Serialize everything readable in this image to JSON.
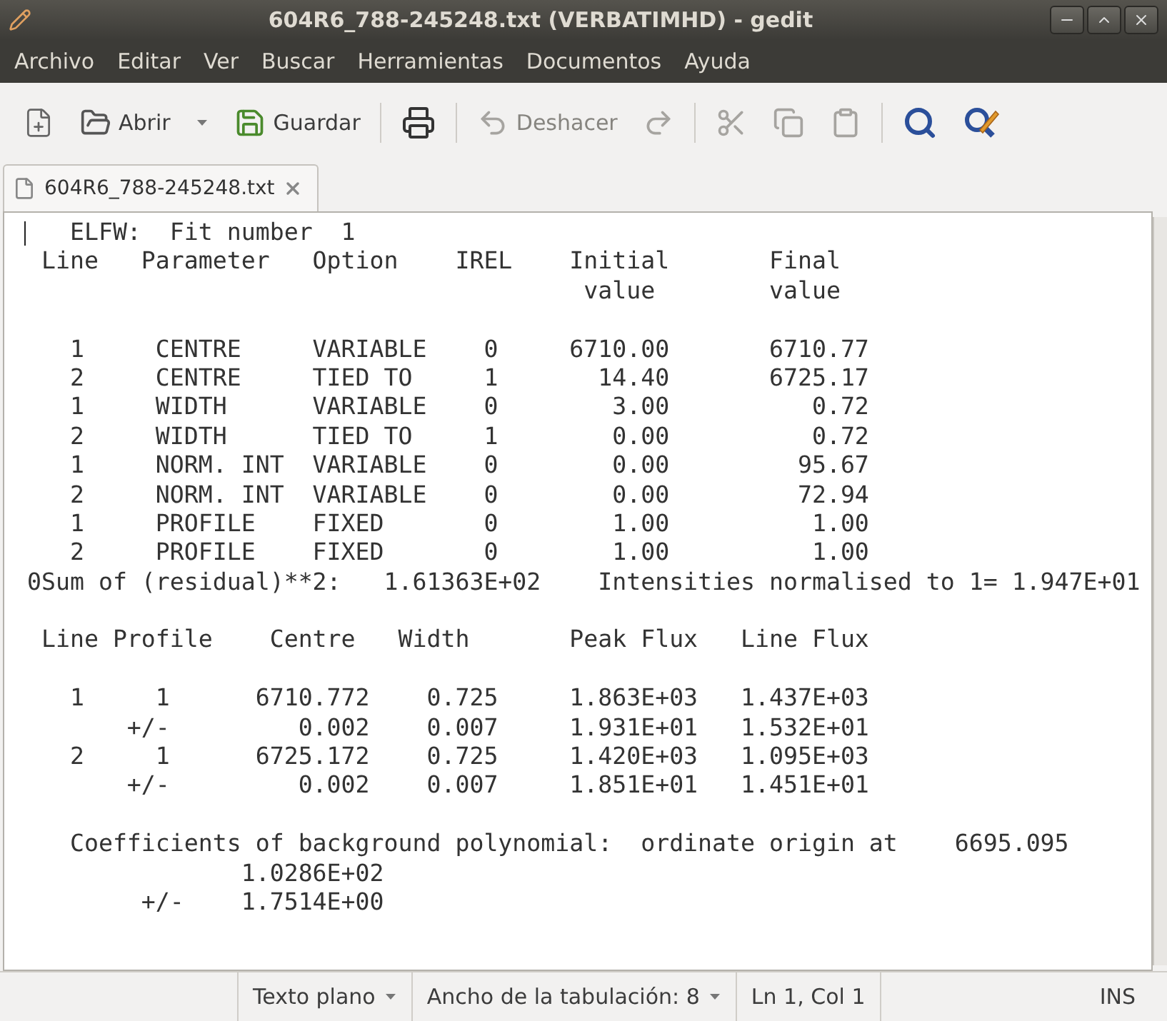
{
  "window": {
    "title": "604R6_788-245248.txt (VERBATIMHD) - gedit"
  },
  "menu": [
    "Archivo",
    "Editar",
    "Ver",
    "Buscar",
    "Herramientas",
    "Documentos",
    "Ayuda"
  ],
  "toolbar": {
    "groups": [
      [
        {
          "disabled": false
        },
        {
          "label": "Abrir",
          "disabled": false,
          "has_menu": true
        },
        {
          "label": "Guardar",
          "disabled": false
        }
      ],
      [
        {
          "disabled": false
        }
      ],
      [
        {
          "label": "Deshacer",
          "disabled": true
        },
        {
          "disabled": true
        }
      ],
      [
        {
          "disabled": true
        },
        {
          "disabled": true
        },
        {
          "disabled": true
        }
      ],
      [
        {
          "disabled": false
        },
        {
          "disabled": false
        }
      ]
    ]
  },
  "tabs": [
    {
      "label": "604R6_788-245248.txt",
      "selected": true
    }
  ],
  "editor": {
    "blocks": [
      [
        "   ELFW:  Fit number  1",
        " Line   Parameter   Option    IREL    Initial       Final",
        "                                       value        value"
      ],
      [
        "   1     CENTRE     VARIABLE    0     6710.00       6710.77",
        "   2     CENTRE     TIED TO     1       14.40       6725.17",
        "   1     WIDTH      VARIABLE    0        3.00          0.72",
        "   2     WIDTH      TIED TO     1        0.00          0.72",
        "   1     NORM. INT  VARIABLE    0        0.00         95.67",
        "   2     NORM. INT  VARIABLE    0        0.00         72.94",
        "   1     PROFILE    FIXED       0        1.00          1.00",
        "   2     PROFILE    FIXED       0        1.00          1.00",
        "0Sum of (residual)**2:   1.61363E+02    Intensities normalised to 1= 1.947E+01"
      ],
      [
        " Line Profile    Centre   Width       Peak Flux   Line Flux"
      ],
      [
        "   1     1      6710.772    0.725     1.863E+03   1.437E+03",
        "       +/-         0.002    0.007     1.931E+01   1.532E+01",
        "   2     1      6725.172    0.725     1.420E+03   1.095E+03",
        "       +/-         0.002    0.007     1.851E+01   1.451E+01"
      ],
      [
        "   Coefficients of background polynomial:  ordinate origin at    6695.095",
        "               1.0286E+02",
        "        +/-    1.7514E+00"
      ]
    ]
  },
  "status_bar": [
    {
      "label": "Texto plano",
      "has_menu": true
    },
    {
      "label": "Ancho de la tabulación: 8",
      "has_menu": true
    },
    {
      "label": "Ln 1, Col 1",
      "has_menu": false
    },
    {
      "label": "INS",
      "has_menu": false
    }
  ]
}
